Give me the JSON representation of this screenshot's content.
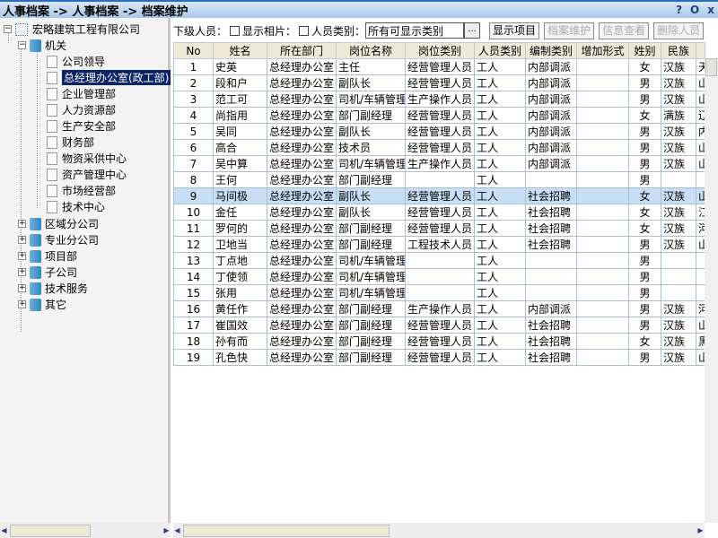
{
  "title": "人事档案 -> 人事档案 -> 档案维护",
  "window_buttons": [
    "?",
    "O",
    "x"
  ],
  "tree": {
    "root": "宏略建筑工程有限公司",
    "group": "机关",
    "children": [
      "公司领导",
      "总经理办公室(政工部)",
      "企业管理部",
      "人力资源部",
      "生产安全部",
      "财务部",
      "物资采供中心",
      "资产管理中心",
      "市场经营部",
      "技术中心"
    ],
    "selected": "总经理办公室(政工部)",
    "collapsed": [
      "区域分公司",
      "专业分公司",
      "项目部",
      "子公司",
      "技术服务",
      "其它"
    ]
  },
  "toolbar": {
    "sub_staff_label": "下级人员：",
    "show_photo_label": "显示相片：",
    "staff_type_label": "人员类别：",
    "staff_type_value": "所有可显示类别",
    "browse": "...",
    "show_items": "显示项目",
    "maintain": "档案维护",
    "view_info": "信息查看",
    "delete_staff": "删除人员"
  },
  "columns": [
    "No",
    "姓名",
    "所在部门",
    "岗位名称",
    "岗位类别",
    "人员类别",
    "编制类别",
    "增加形式",
    "姓别",
    "民族",
    ""
  ],
  "selected_row": 9,
  "rows": [
    [
      "1",
      "史英",
      "总经理办公室",
      "主任",
      "经营管理人员",
      "工人",
      "内部调派",
      "",
      "女",
      "汉族",
      "天"
    ],
    [
      "2",
      "段和户",
      "总经理办公室",
      "副队长",
      "经营管理人员",
      "工人",
      "内部调派",
      "",
      "男",
      "汉族",
      "山"
    ],
    [
      "3",
      "范工可",
      "总经理办公室",
      "司机/车辆管理",
      "生产操作人员",
      "工人",
      "内部调派",
      "",
      "男",
      "汉族",
      "山"
    ],
    [
      "4",
      "尚指用",
      "总经理办公室",
      "部门副经理",
      "经营管理人员",
      "工人",
      "内部调派",
      "",
      "女",
      "满族",
      "辽"
    ],
    [
      "5",
      "吴同",
      "总经理办公室",
      "副队长",
      "经营管理人员",
      "工人",
      "内部调派",
      "",
      "男",
      "汉族",
      "内"
    ],
    [
      "6",
      "高合",
      "总经理办公室",
      "技术员",
      "经营管理人员",
      "工人",
      "内部调派",
      "",
      "男",
      "汉族",
      "山"
    ],
    [
      "7",
      "吴中算",
      "总经理办公室",
      "司机/车辆管理",
      "生产操作人员",
      "工人",
      "内部调派",
      "",
      "男",
      "汉族",
      "山"
    ],
    [
      "8",
      "王何",
      "总经理办公室",
      "部门副经理",
      "",
      "工人",
      "",
      "",
      "男",
      "",
      ""
    ],
    [
      "9",
      "马间极",
      "总经理办公室",
      "副队长",
      "经营管理人员",
      "工人",
      "社会招聘",
      "",
      "女",
      "汉族",
      "山"
    ],
    [
      "10",
      "金任",
      "总经理办公室",
      "副队长",
      "经营管理人员",
      "工人",
      "社会招聘",
      "",
      "女",
      "汉族",
      "江"
    ],
    [
      "11",
      "罗何的",
      "总经理办公室",
      "部门副经理",
      "经营管理人员",
      "工人",
      "社会招聘",
      "",
      "女",
      "汉族",
      "河"
    ],
    [
      "12",
      "卫地当",
      "总经理办公室",
      "部门副经理",
      "工程技术人员",
      "工人",
      "社会招聘",
      "",
      "男",
      "汉族",
      "山"
    ],
    [
      "13",
      "丁点地",
      "总经理办公室",
      "司机/车辆管理",
      "",
      "工人",
      "",
      "",
      "男",
      "",
      ""
    ],
    [
      "14",
      "丁使领",
      "总经理办公室",
      "司机/车辆管理",
      "",
      "工人",
      "",
      "",
      "男",
      "",
      ""
    ],
    [
      "15",
      "张用",
      "总经理办公室",
      "司机/车辆管理",
      "",
      "工人",
      "",
      "",
      "男",
      "",
      ""
    ],
    [
      "16",
      "黄任作",
      "总经理办公室",
      "部门副经理",
      "生产操作人员",
      "工人",
      "内部调派",
      "",
      "男",
      "汉族",
      "河"
    ],
    [
      "17",
      "崔国效",
      "总经理办公室",
      "部门副经理",
      "经营管理人员",
      "工人",
      "社会招聘",
      "",
      "男",
      "汉族",
      "山"
    ],
    [
      "18",
      "孙有而",
      "总经理办公室",
      "部门副经理",
      "经营管理人员",
      "工人",
      "社会招聘",
      "",
      "女",
      "汉族",
      "黑"
    ],
    [
      "19",
      "孔色快",
      "总经理办公室",
      "部门副经理",
      "经营管理人员",
      "工人",
      "社会招聘",
      "",
      "男",
      "汉族",
      "山"
    ]
  ]
}
